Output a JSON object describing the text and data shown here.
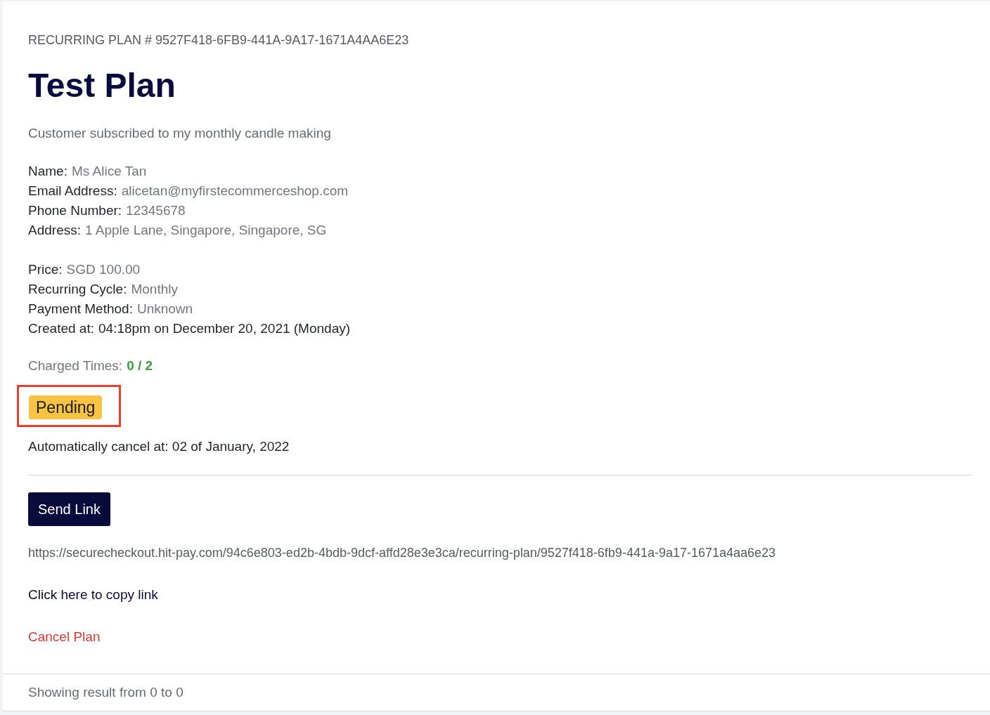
{
  "plan_id": "RECURRING PLAN # 9527F418-6FB9-441A-9A17-1671A4AA6E23",
  "title": "Test Plan",
  "description": "Customer subscribed to my monthly candle making",
  "customer_fields": [
    {
      "label": "Name:",
      "value": "Ms Alice Tan",
      "kind": "muted"
    },
    {
      "label": "Email Address:",
      "value": "alicetan@myfirstecommerceshop.com",
      "kind": "muted"
    },
    {
      "label": "Phone Number:",
      "value": "12345678",
      "kind": "muted"
    },
    {
      "label": "Address:",
      "value": "1 Apple Lane, Singapore, Singapore, SG",
      "kind": "muted"
    }
  ],
  "plan_fields": [
    {
      "label": "Price:",
      "value": "SGD 100.00",
      "kind": "muted"
    },
    {
      "label": "Recurring Cycle:",
      "value": "Monthly",
      "kind": "muted"
    },
    {
      "label": "Payment Method:",
      "value": "Unknown",
      "kind": "muted"
    },
    {
      "label": "Created at:",
      "value": "04:18pm on December 20, 2021 (Monday)",
      "kind": "plain"
    }
  ],
  "charged_times": {
    "label": "Charged Times:",
    "value": "0 / 2"
  },
  "status": {
    "label": "Pending",
    "kind": "pending",
    "highlighted": true
  },
  "cancel_notice": "Automatically cancel at: 02 of January, 2022",
  "send_button": "Send Link",
  "checkout_url": "https://securecheckout.hit-pay.com/94c6e803-ed2b-4bdb-9dcf-affd28e3e3ca/recurring-plan/9527f418-6fb9-441a-9a17-1671a4aa6e23",
  "copy_link": "Click here to copy link",
  "cancel_link": "Cancel Plan",
  "footer": "Showing result from 0 to 0"
}
